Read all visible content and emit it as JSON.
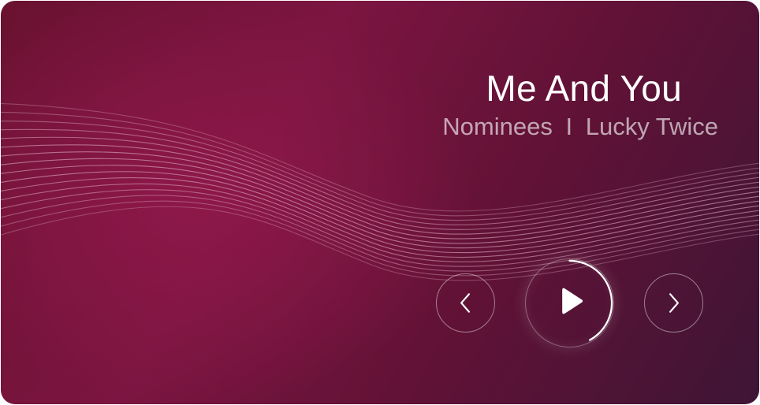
{
  "track": {
    "title": "Me And You",
    "artist": "Nominees",
    "separator": "I",
    "album": "Lucky Twice"
  },
  "controls": {
    "previous_icon": "chevron-left-icon",
    "play_icon": "play-icon",
    "next_icon": "chevron-right-icon"
  },
  "playback": {
    "progress": 0.42
  },
  "colors": {
    "background_primary": "#7c1541",
    "background_secondary": "#3e1535",
    "text_primary": "#ffffff",
    "wave_lines": "#d9a3bd"
  }
}
